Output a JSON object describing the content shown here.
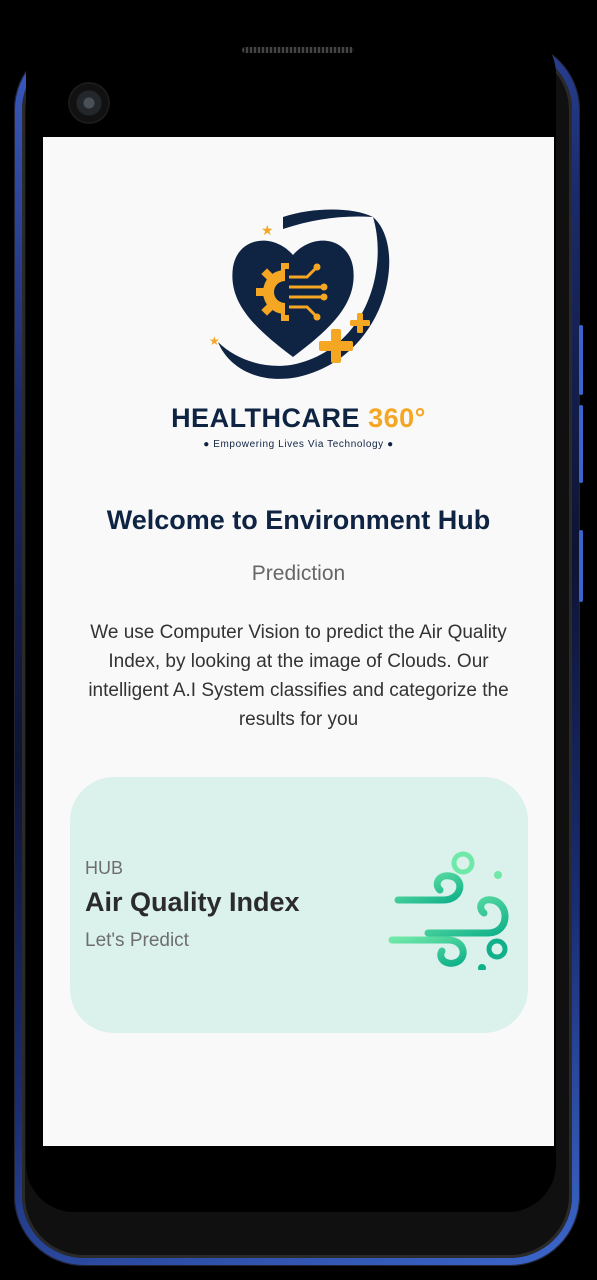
{
  "app": {
    "brand_name": "HEALTHCARE",
    "brand_number": "360°",
    "tagline": "● Empowering Lives Via Technology ●",
    "logo_icon": "heart-gear-circuit-logo"
  },
  "main": {
    "title": "Welcome to Environment Hub",
    "subtitle": "Prediction",
    "description": "We use Computer Vision to predict the Air Quality Index, by looking at the image of Clouds. Our intelligent A.I System classifies and categorize the results for you"
  },
  "card": {
    "hub_label": "HUB",
    "title": "Air Quality Index",
    "action": "Let's Predict",
    "icon": "wind-icon",
    "background": "#dbf2ec"
  },
  "colors": {
    "navy": "#0f2443",
    "orange": "#f5a623",
    "green_start": "#5ee0a0",
    "green_end": "#12b38a"
  }
}
